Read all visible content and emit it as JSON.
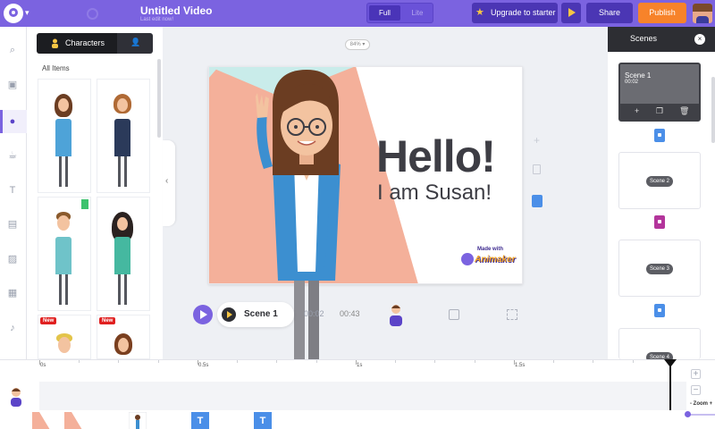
{
  "header": {
    "title": "Untitled Video",
    "subtitle": "Last edit now!",
    "mode_full": "Full",
    "mode_lite": "Lite",
    "upgrade_label": "Upgrade to starter",
    "share_label": "Share",
    "publish_label": "Publish"
  },
  "library": {
    "tab_characters": "Characters",
    "section_label": "All Items",
    "new_badge": "New"
  },
  "canvas": {
    "zoom": "84%",
    "headline": "Hello!",
    "tagline": "I am Susan!",
    "watermark_small": "Made with",
    "watermark_brand": "Animaker"
  },
  "player": {
    "scene_label": "Scene 1",
    "current_time": "00:02",
    "total_time": "00:43"
  },
  "scenes": {
    "header": "Scenes",
    "close_glyph": "×",
    "items": [
      {
        "name": "Scene 1",
        "duration": "00:02"
      },
      {
        "name": "Scene 2"
      },
      {
        "name": "Scene 3"
      },
      {
        "name": "Scene 4"
      }
    ]
  },
  "timeline": {
    "ticks": [
      "0s",
      "0.5s",
      "1s",
      "1.5s"
    ],
    "zoom_label": "- Zoom +",
    "plus": "+",
    "minus": "−",
    "text_clip": "T"
  },
  "colors": {
    "brand": "#7b63e0",
    "publish": "#f7832a",
    "accent_blue": "#4b8fe8",
    "salmon": "#f4b09a"
  }
}
